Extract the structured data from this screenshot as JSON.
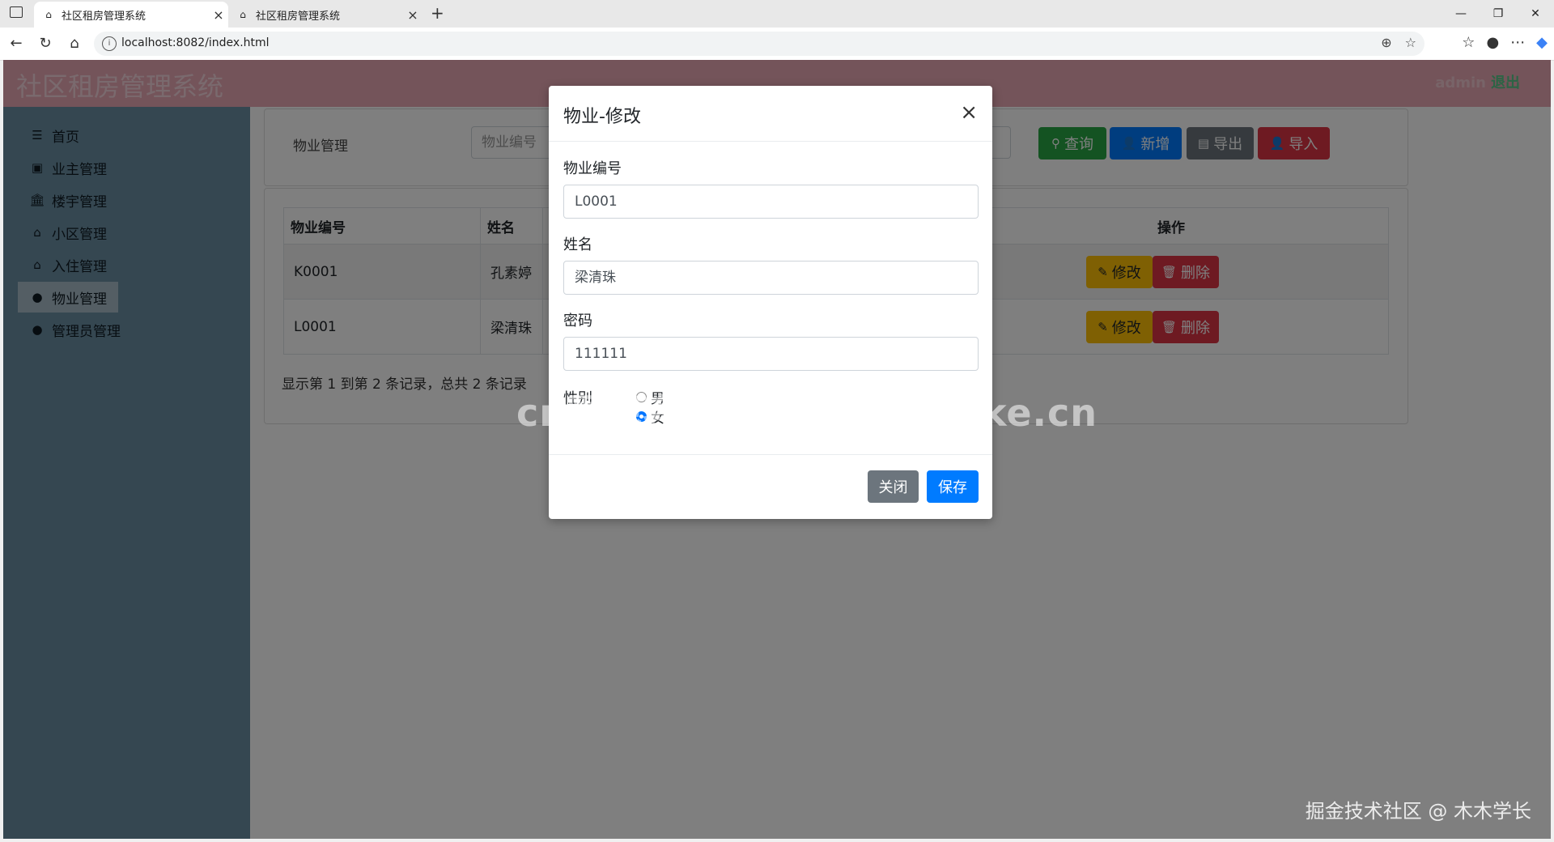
{
  "browser": {
    "tabs": [
      {
        "title": "社区租房管理系统",
        "active": true
      },
      {
        "title": "社区租房管理系统",
        "active": false
      }
    ],
    "url": "localhost:8082/index.html",
    "new_tab": "+"
  },
  "header": {
    "brand": "社区租房管理系统",
    "user": "admin",
    "logout": "退出"
  },
  "sidebar": {
    "items": [
      {
        "label": "首页",
        "icon": "menu-icon"
      },
      {
        "label": "业主管理",
        "icon": "id-card-icon"
      },
      {
        "label": "楼宇管理",
        "icon": "bank-icon"
      },
      {
        "label": "小区管理",
        "icon": "home-icon"
      },
      {
        "label": "入住管理",
        "icon": "home-icon"
      },
      {
        "label": "物业管理",
        "icon": "user-icon",
        "active": true
      },
      {
        "label": "管理员管理",
        "icon": "user-icon"
      }
    ]
  },
  "search": {
    "label": "物业管理",
    "placeholder": "物业编号",
    "query_btn": "查询",
    "add_btn": "新增",
    "export_btn": "导出",
    "import_btn": "导入"
  },
  "table": {
    "headers": {
      "code": "物业编号",
      "name": "姓名",
      "ops": "操作"
    },
    "rows": [
      {
        "code": "K0001",
        "name": "孔素婷"
      },
      {
        "code": "L0001",
        "name": "梁清珠"
      }
    ],
    "edit_btn": "修改",
    "delete_btn": "删除",
    "summary": "显示第 1 到第 2 条记录，总共 2 条记录"
  },
  "modal": {
    "title": "物业-修改",
    "close_x": "×",
    "fields": {
      "code_label": "物业编号",
      "code_value": "L0001",
      "name_label": "姓名",
      "name_value": "梁清珠",
      "password_label": "密码",
      "password_value": "111111",
      "gender_label": "性别",
      "gender_male": "男",
      "gender_female": "女",
      "gender_selected": "女"
    },
    "close_btn": "关闭",
    "save_btn": "保存"
  },
  "watermarks": {
    "center": "cn围观客www.weiguanke.cn",
    "corner": "掘金技术社区 @ 木木学长"
  },
  "colors": {
    "header_bg": "#e8a8b4",
    "sidebar_bg": "#6b8ea3",
    "primary": "#007bff",
    "success": "#28a745",
    "danger": "#dc3545",
    "warning": "#ffc107",
    "secondary": "#6c757d"
  }
}
